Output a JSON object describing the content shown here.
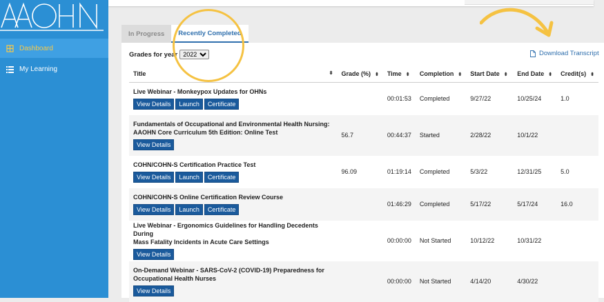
{
  "brand": {
    "logo_text": "AAOHN",
    "accent": "#2b8fd4"
  },
  "sidebar": {
    "items": [
      {
        "label": "Dashboard",
        "icon": "dashboard-icon",
        "active": true
      },
      {
        "label": "My Learning",
        "icon": "list-icon",
        "active": false
      }
    ]
  },
  "tabs": [
    {
      "label": "In Progress",
      "active": false
    },
    {
      "label": "Recently Completed",
      "active": true
    }
  ],
  "filter": {
    "label": "Grades for year",
    "selected": "2022"
  },
  "download": {
    "label": "Download Transcript",
    "icon": "document-icon"
  },
  "table": {
    "headers": [
      "Title",
      "Grade (%)",
      "Time",
      "Completion",
      "Start Date",
      "End Date",
      "Credit(s)"
    ],
    "rows": [
      {
        "title_lines": [
          "Live Webinar - Monkeypox Updates for OHNs"
        ],
        "grade": "",
        "time": "00:01:53",
        "completion": "Completed",
        "start": "9/27/22",
        "end": "10/25/24",
        "credits": "1.0",
        "buttons": [
          "View Details",
          "Launch",
          "Certificate"
        ]
      },
      {
        "title_lines": [
          "Fundamentals of Occupational and Environmental Health Nursing:",
          "AAOHN Core Curriculum 5th Edition: Online Test"
        ],
        "grade": "56.7",
        "time": "00:44:37",
        "completion": "Started",
        "start": "2/28/22",
        "end": "10/1/22",
        "credits": "",
        "buttons": [
          "View Details"
        ]
      },
      {
        "title_lines": [
          "COHN/COHN-S Certification Practice Test"
        ],
        "grade": "96.09",
        "time": "01:19:14",
        "completion": "Completed",
        "start": "5/3/22",
        "end": "12/31/25",
        "credits": "5.0",
        "buttons": [
          "View Details",
          "Launch",
          "Certificate"
        ]
      },
      {
        "title_lines": [
          "COHN/COHN-S Online Certification Review Course"
        ],
        "grade": "",
        "time": "01:46:29",
        "completion": "Completed",
        "start": "5/17/22",
        "end": "5/17/24",
        "credits": "16.0",
        "buttons": [
          "View Details",
          "Launch",
          "Certificate"
        ]
      },
      {
        "title_lines": [
          "Live Webinar - Ergonomics Guidelines for Handling Decedents During",
          "Mass Fatality Incidents in Acute Care Settings"
        ],
        "grade": "",
        "time": "00:00:00",
        "completion": "Not Started",
        "start": "10/12/22",
        "end": "10/31/22",
        "credits": "",
        "buttons": [
          "View Details"
        ]
      },
      {
        "title_lines": [
          "On-Demand Webinar - SARS-CoV-2 (COVID-19) Preparedness for",
          "Occupational Health Nurses"
        ],
        "grade": "",
        "time": "00:00:00",
        "completion": "Not Started",
        "start": "4/14/20",
        "end": "4/30/22",
        "credits": "",
        "buttons": [
          "View Details"
        ]
      }
    ]
  },
  "annotation_color": "#f5c242"
}
